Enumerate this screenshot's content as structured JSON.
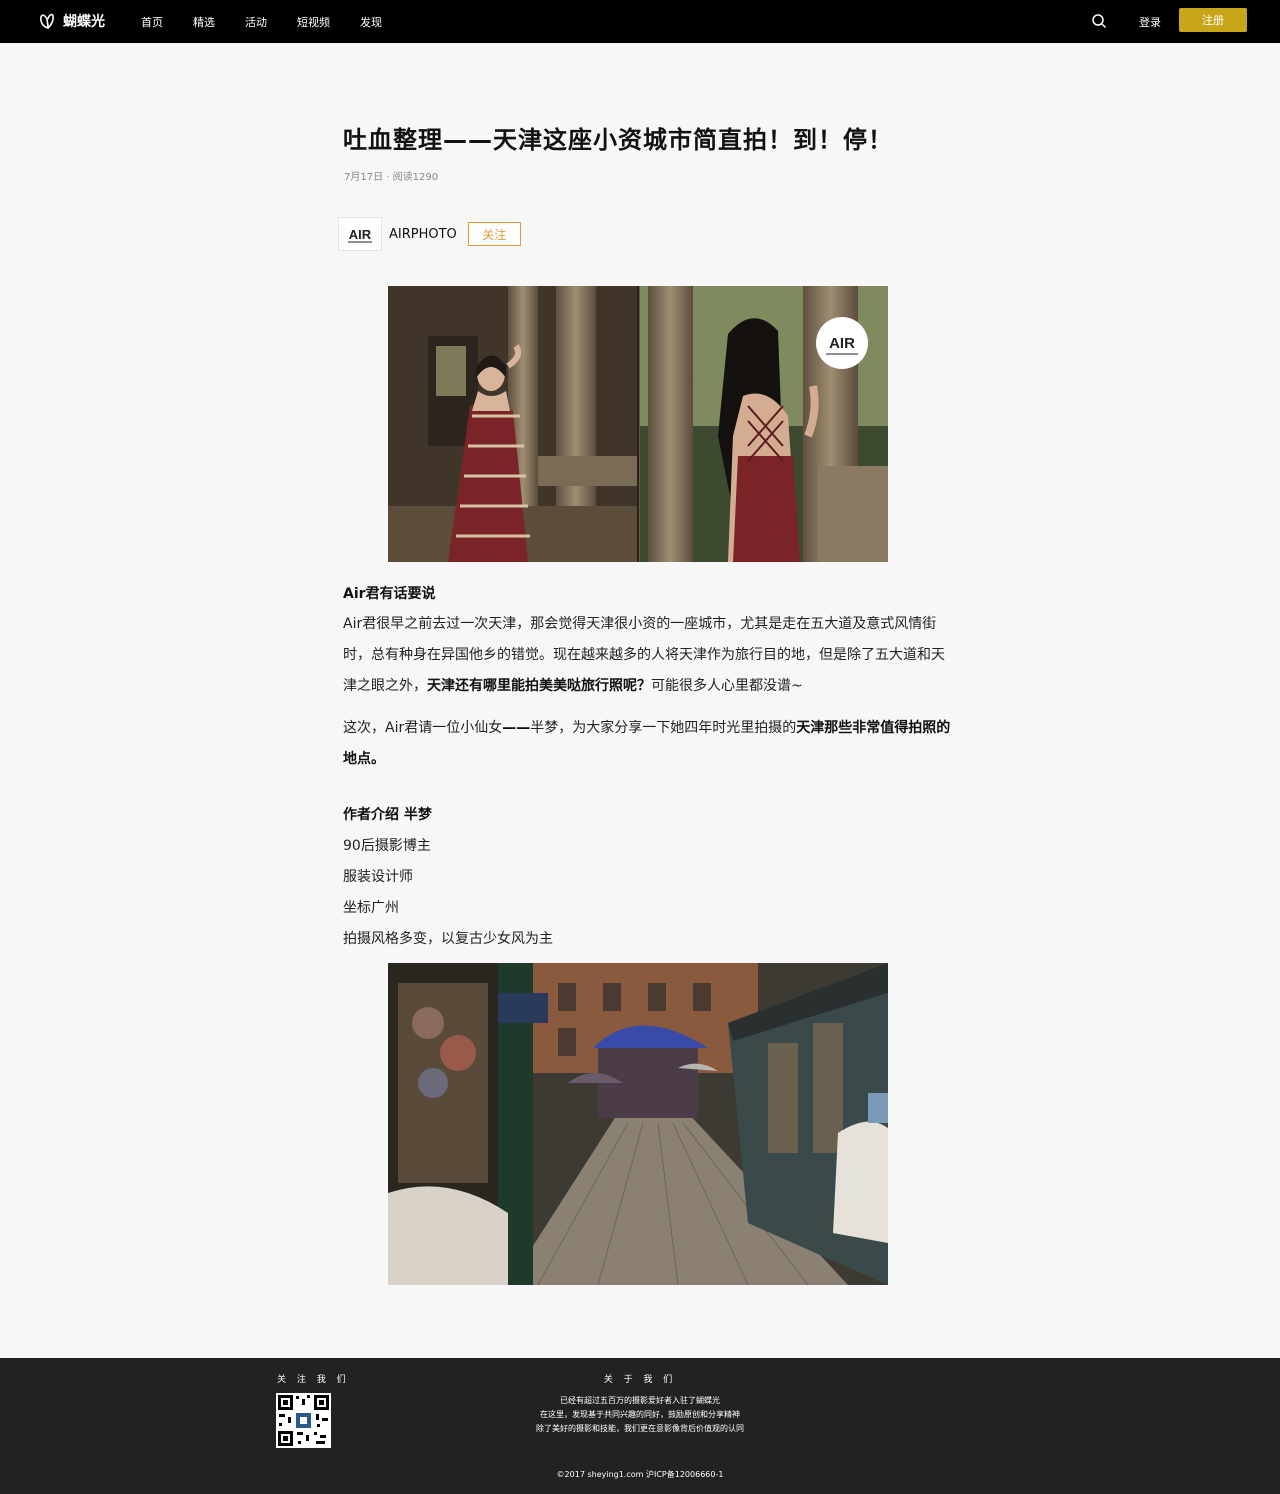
{
  "header": {
    "logo_text": "蝴蝶光",
    "nav": [
      "首页",
      "精选",
      "活动",
      "短视频",
      "发现"
    ],
    "login": "登录",
    "register": "注册",
    "accent_color": "#c9a51a"
  },
  "article": {
    "title": "吐血整理——天津这座小资城市简直拍！到！停！",
    "meta": "7月17日 · 阅读1290",
    "author": "AIRPHOTO",
    "follow": "关注",
    "avatar_text": "AIR",
    "photo_watermark": "AIR",
    "section1_heading": "Air君有话要说",
    "p1_part1": "Air君很早之前去过一次天津，那会觉得天津很小资的一座城市，尤其是走在五大道及意式风情街时，总有种身在异国他乡的错觉。现在越来越多的人将天津作为旅行目的地，但是除了五大道和天津之眼之外，",
    "p1_bold": "天津还有哪里能拍美美哒旅行照呢？",
    "p1_part2": "可能很多人心里都没谱~",
    "p2_part1": "这次，Air君请一位小仙女",
    "p2_bold1": "——",
    "p2_part2": "半梦，为大家分享一下她四年时光里拍摄的",
    "p2_bold2": "天津那些非常值得拍照的地点。",
    "section2_heading": "作者介绍 半梦",
    "bio": [
      "90后摄影博主",
      "服装设计师",
      "坐标广州",
      "拍摄风格多变，以复古少女风为主"
    ]
  },
  "footer": {
    "follow_heading": "关 注 我 们",
    "about_heading": "关 于 我 们",
    "about_lines": [
      "已经有超过五百万的摄影爱好者入驻了蝴蝶光",
      "在这里，发现基于共同兴趣的同好，鼓励原创和分享精神",
      "除了美好的摄影和技能，我们更在意影像背后价值观的认同"
    ],
    "copyright": "©2017 sheying1.com 沪ICP备12006660-1"
  }
}
